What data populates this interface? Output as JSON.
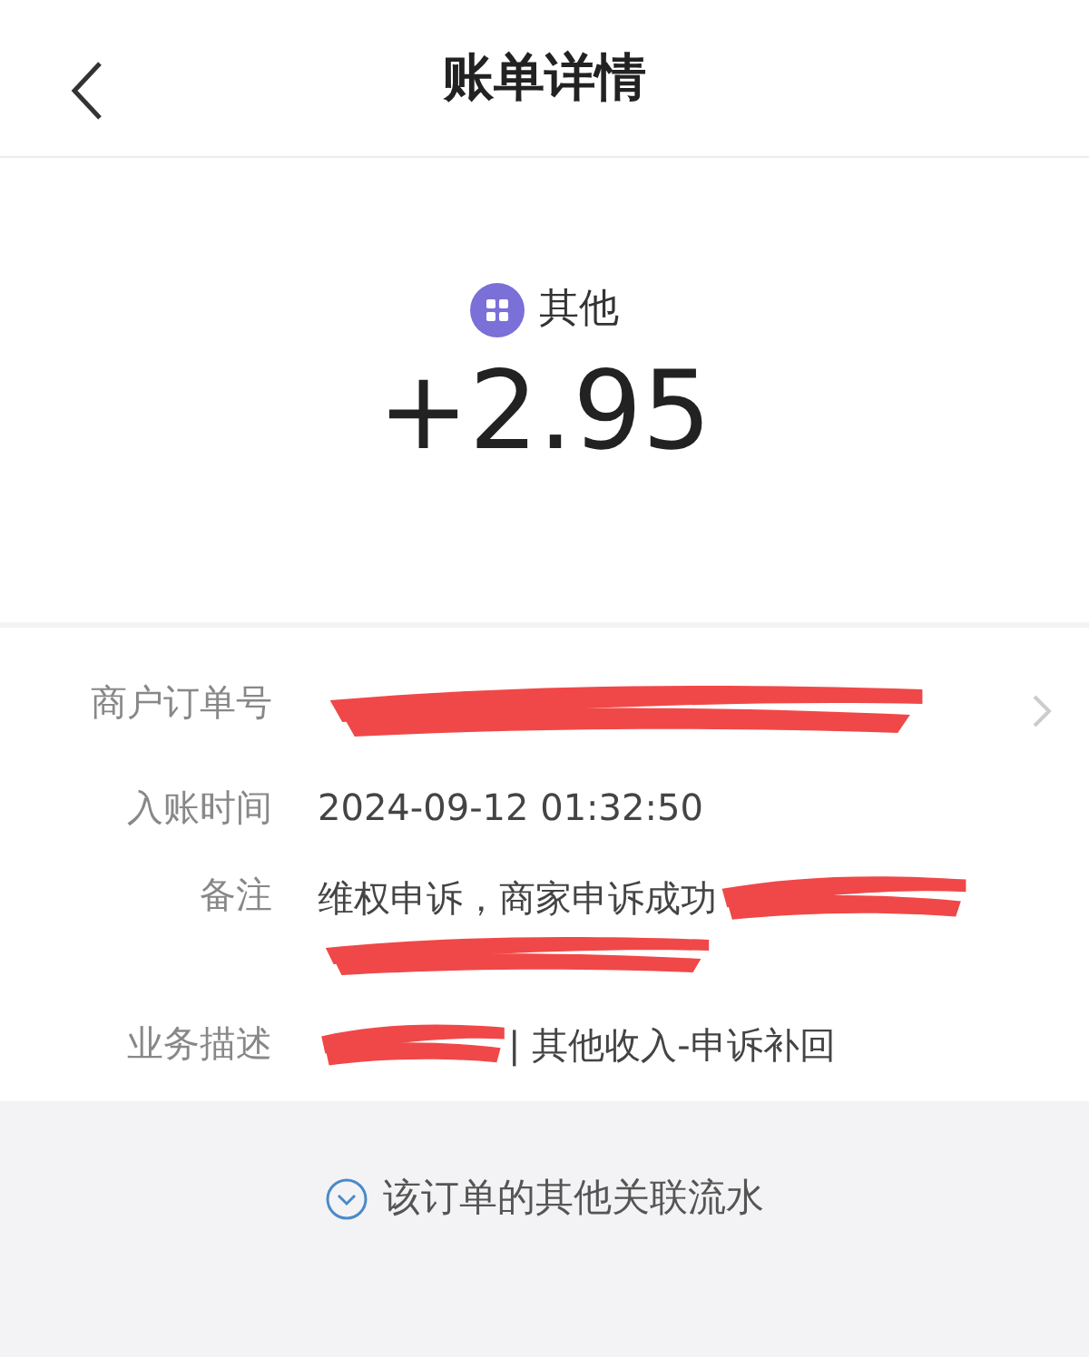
{
  "header": {
    "title": "账单详情"
  },
  "summary": {
    "category": "其他",
    "amount": "+2.95"
  },
  "details": [
    {
      "kind": "link",
      "label": "商户订单号"
    },
    {
      "kind": "text",
      "label": "入账时间",
      "value": "2024-09-12 01:32:50"
    },
    {
      "kind": "remark",
      "label": "备注",
      "value": "维权申诉，商家申诉成功"
    },
    {
      "kind": "prefixed",
      "label": "业务描述",
      "value": "| 其他收入-申诉补回"
    }
  ],
  "footer": {
    "link": "该订单的其他关联流水"
  }
}
